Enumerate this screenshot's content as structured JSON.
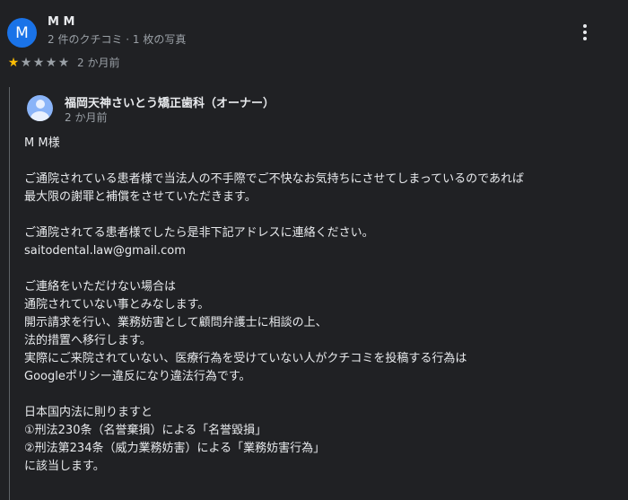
{
  "review": {
    "avatar_letter": "M",
    "reviewer_name": "M M",
    "reviewer_meta": "2 件のクチコミ · 1 枚の写真",
    "rating": 1,
    "stars": [
      "★",
      "★",
      "★",
      "★",
      "★"
    ],
    "date": "2 か月前"
  },
  "owner_reply": {
    "name": "福岡天神さいとう矯正歯科（オーナー）",
    "date": "2 か月前",
    "lines": [
      "M M様",
      "",
      "ご通院されている患者様で当法人の不手際でご不快なお気持ちにさせてしまっているのであれば",
      "最大限の謝罪と補償をさせていただきます。",
      "",
      "ご通院されてる患者様でしたら是非下記アドレスに連絡ください。",
      "saitodental.law@gmail.com",
      "",
      "ご連絡をいただけない場合は",
      "通院されていない事とみなします。",
      "開示請求を行い、業務妨害として顧問弁護士に相談の上、",
      "法的措置へ移行します。",
      "実際にご来院されていない、医療行為を受けていない人がクチコミを投稿する行為は",
      "Googleポリシー違反になり違法行為です。",
      "",
      "日本国内法に則りますと",
      "①刑法230条（名誉棄損）による「名誉毀損」",
      "②刑法第234条（威力業務妨害）による「業務妨害行為」",
      "に該当します。"
    ]
  },
  "colors": {
    "background": "#202124",
    "avatar": "#1a73e8",
    "star_filled": "#fbbc04",
    "text_secondary": "#9aa0a6"
  },
  "icons": {
    "more": "more-vert-icon",
    "owner_avatar": "person-icon"
  }
}
